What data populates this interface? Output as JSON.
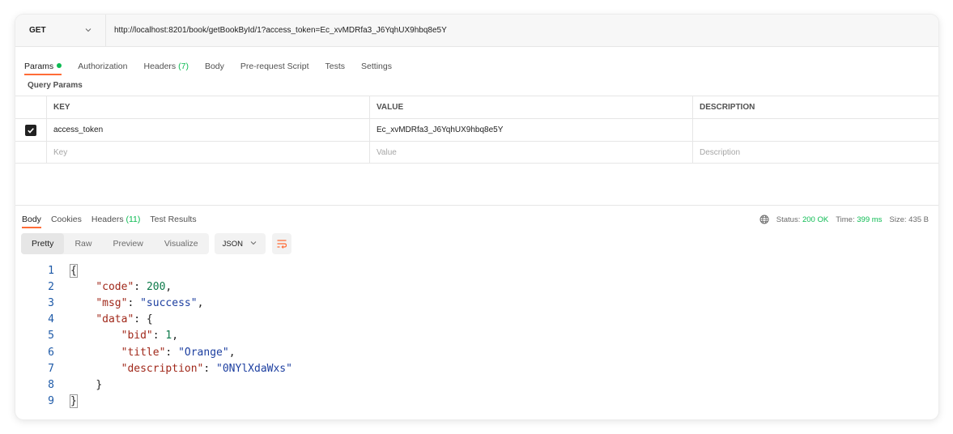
{
  "request": {
    "method": "GET",
    "url": "http://localhost:8201/book/getBookById/1?access_token=Ec_xvMDRfa3_J6YqhUX9hbq8e5Y"
  },
  "request_tabs": [
    {
      "label": "Params",
      "count": ""
    },
    {
      "label": "Authorization",
      "count": ""
    },
    {
      "label": "Headers",
      "count": "(7)"
    },
    {
      "label": "Body",
      "count": ""
    },
    {
      "label": "Pre-request Script",
      "count": ""
    },
    {
      "label": "Tests",
      "count": ""
    },
    {
      "label": "Settings",
      "count": ""
    }
  ],
  "query_params": {
    "label": "Query Params",
    "headers": {
      "key": "KEY",
      "value": "VALUE",
      "description": "DESCRIPTION"
    },
    "rows": [
      {
        "key": "access_token",
        "value": "Ec_xvMDRfa3_J6YqhUX9hbq8e5Y",
        "description": "",
        "checked": true
      }
    ],
    "placeholders": {
      "key": "Key",
      "value": "Value",
      "description": "Description"
    }
  },
  "response_tabs": [
    {
      "label": "Body",
      "count": ""
    },
    {
      "label": "Cookies",
      "count": ""
    },
    {
      "label": "Headers",
      "count": "(11)"
    },
    {
      "label": "Test Results",
      "count": ""
    }
  ],
  "status": {
    "status_label": "Status:",
    "status_value": "200 OK",
    "time_label": "Time:",
    "time_value": "399 ms",
    "size_label": "Size:",
    "size_value": "435 B"
  },
  "view_modes": [
    "Pretty",
    "Raw",
    "Preview",
    "Visualize"
  ],
  "format": "JSON",
  "code_lines": [
    {
      "n": "1",
      "indent": "",
      "parts": [
        {
          "t": "p",
          "v": "{"
        }
      ]
    },
    {
      "n": "2",
      "indent": "    ",
      "parts": [
        {
          "t": "k",
          "v": "\"code\""
        },
        {
          "t": "p",
          "v": ": "
        },
        {
          "t": "n",
          "v": "200"
        },
        {
          "t": "p",
          "v": ","
        }
      ]
    },
    {
      "n": "3",
      "indent": "    ",
      "parts": [
        {
          "t": "k",
          "v": "\"msg\""
        },
        {
          "t": "p",
          "v": ": "
        },
        {
          "t": "s",
          "v": "\"success\""
        },
        {
          "t": "p",
          "v": ","
        }
      ]
    },
    {
      "n": "4",
      "indent": "    ",
      "parts": [
        {
          "t": "k",
          "v": "\"data\""
        },
        {
          "t": "p",
          "v": ": {"
        }
      ]
    },
    {
      "n": "5",
      "indent": "        ",
      "parts": [
        {
          "t": "k",
          "v": "\"bid\""
        },
        {
          "t": "p",
          "v": ": "
        },
        {
          "t": "n",
          "v": "1"
        },
        {
          "t": "p",
          "v": ","
        }
      ]
    },
    {
      "n": "6",
      "indent": "        ",
      "parts": [
        {
          "t": "k",
          "v": "\"title\""
        },
        {
          "t": "p",
          "v": ": "
        },
        {
          "t": "s",
          "v": "\"Orange\""
        },
        {
          "t": "p",
          "v": ","
        }
      ]
    },
    {
      "n": "7",
      "indent": "        ",
      "parts": [
        {
          "t": "k",
          "v": "\"description\""
        },
        {
          "t": "p",
          "v": ": "
        },
        {
          "t": "s",
          "v": "\"0NYlXdaWxs\""
        }
      ]
    },
    {
      "n": "8",
      "indent": "    ",
      "parts": [
        {
          "t": "p",
          "v": "}"
        }
      ]
    },
    {
      "n": "9",
      "indent": "",
      "parts": [
        {
          "t": "p",
          "v": "}"
        }
      ]
    }
  ],
  "colors": {
    "accent": "#ff6c37",
    "success": "#0cbb52"
  },
  "icons": {
    "method_dropdown": "chevron-down-icon",
    "globe": "globe-icon",
    "wrap": "wrap-lines-icon",
    "check": "check-icon"
  }
}
